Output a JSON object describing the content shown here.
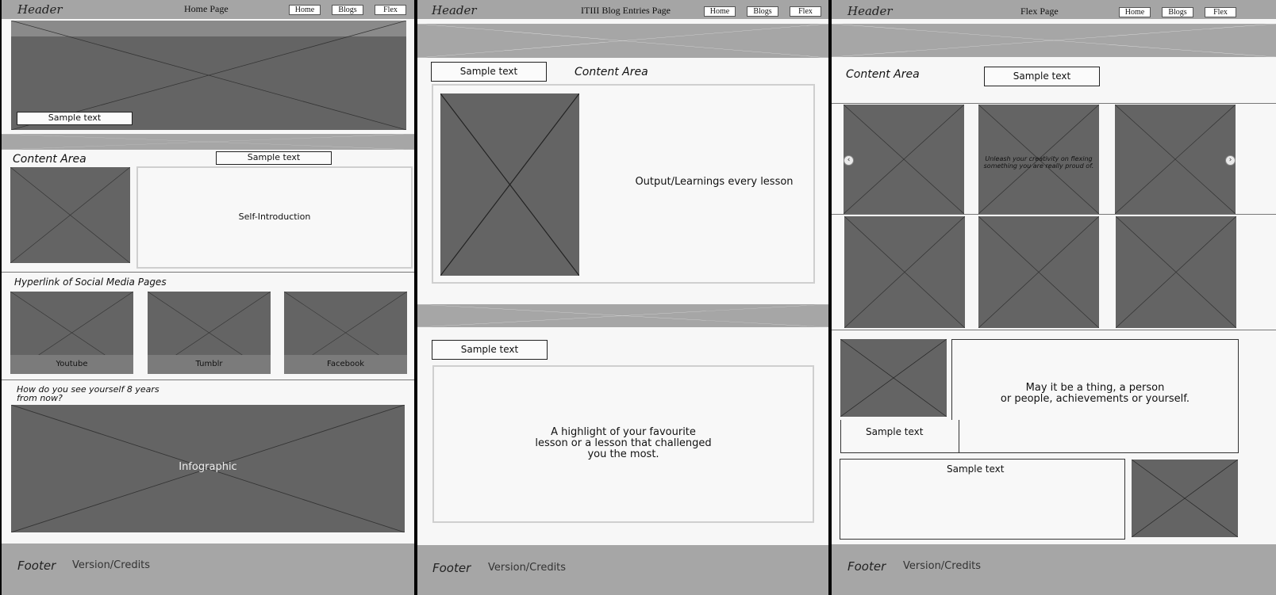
{
  "common": {
    "header_label": "Header",
    "nav": {
      "home": "Home",
      "blogs": "Blogs",
      "flex": "Flex"
    },
    "sample_text": "Sample text",
    "content_area": "Content Area",
    "footer_label": "Footer",
    "footer_version": "Version/Credits"
  },
  "home": {
    "page_title": "Home Page",
    "self_intro": "Self-Introduction",
    "social_heading": "Hyperlink of Social Media Pages",
    "social": [
      "Youtube",
      "Tumblr",
      "Facebook"
    ],
    "future_question_line1": "How do you see yourself 8 years",
    "future_question_line2": "from now?",
    "infographic": "Infographic"
  },
  "blog": {
    "page_title": "ITIII Blog Entries Page",
    "output_text": "Output/Learnings every lesson",
    "highlight_line1": "A highlight of your favourite",
    "highlight_line2": "lesson or a lesson that challenged",
    "highlight_line3": "you the most."
  },
  "flex": {
    "page_title": "Flex Page",
    "unleash_line1": "Unleash your creativity on flexing",
    "unleash_line2": "something you are really proud of.",
    "may_line1": "May it be a thing, a person",
    "may_line2": "or people, achievements or yourself."
  }
}
